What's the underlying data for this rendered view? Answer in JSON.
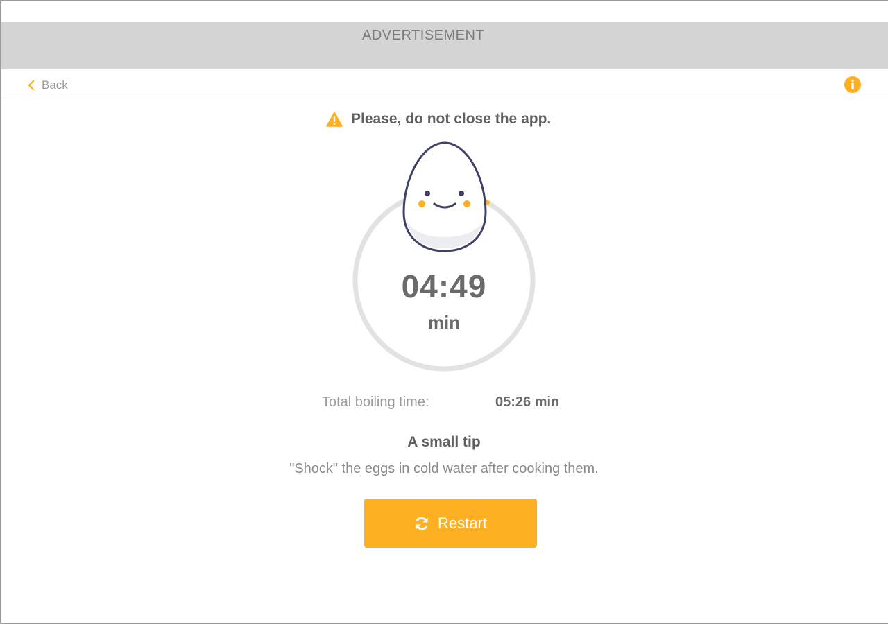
{
  "ad": {
    "label": "ADVERTISEMENT"
  },
  "nav": {
    "back_label": "Back",
    "back_icon": "chevron-left-icon",
    "info_icon": "info-icon"
  },
  "warning": {
    "icon": "warning-triangle-icon",
    "text": "Please, do not close the app."
  },
  "timer": {
    "remaining": "04:49",
    "unit": "min",
    "progress_elapsed_fraction": 0.085
  },
  "total": {
    "label": "Total boiling time:",
    "value": "05:26 min"
  },
  "tip": {
    "title": "A small tip",
    "text": "\"Shock\" the eggs in cold water after cooking them."
  },
  "actions": {
    "restart_label": "Restart",
    "restart_icon": "refresh-icon"
  },
  "colors": {
    "accent": "#fdb022",
    "ring_track": "#e2e2e2",
    "egg_outline": "#3f4266",
    "ad_background": "#d4d4d4"
  }
}
